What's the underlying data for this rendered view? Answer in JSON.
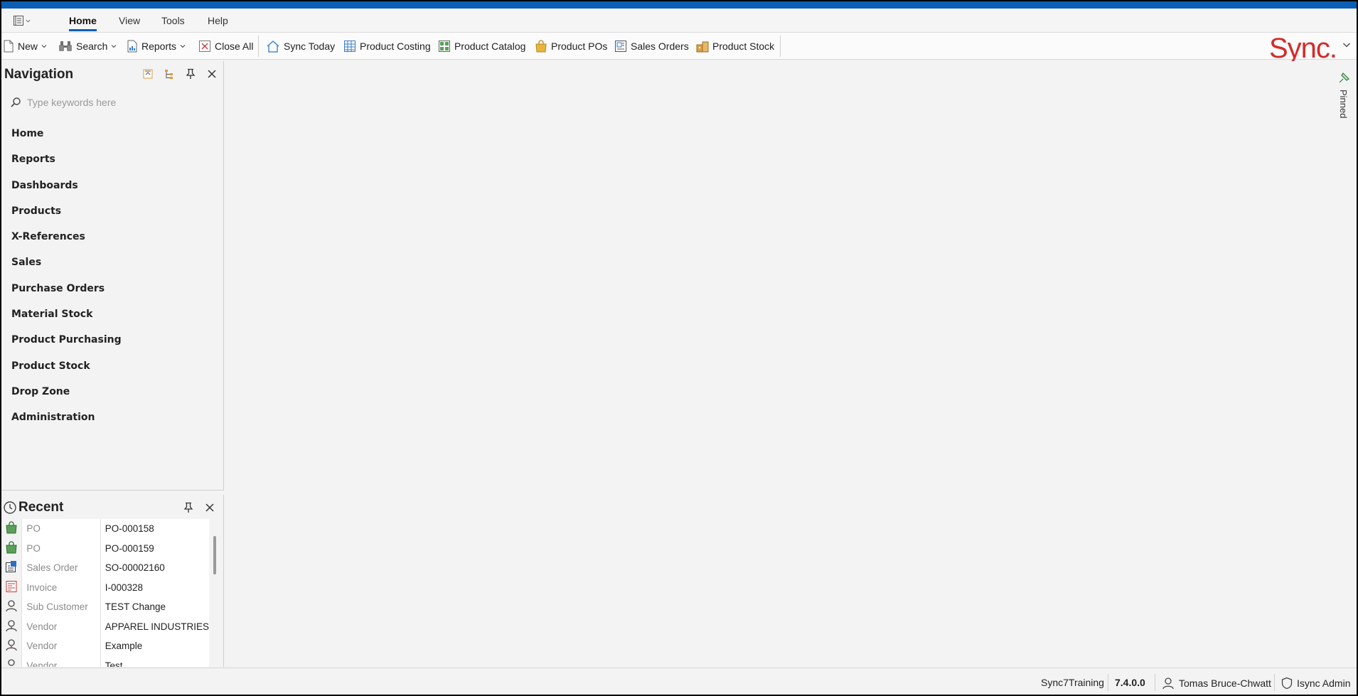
{
  "menubar": {
    "tabs": [
      {
        "label": "Home",
        "active": true
      },
      {
        "label": "View",
        "active": false
      },
      {
        "label": "Tools",
        "active": false
      },
      {
        "label": "Help",
        "active": false
      }
    ]
  },
  "toolbar": {
    "new_label": "New",
    "search_label": "Search",
    "reports_label": "Reports",
    "close_all_label": "Close All",
    "sync_today_label": "Sync Today",
    "product_costing_label": "Product Costing",
    "product_catalog_label": "Product Catalog",
    "product_pos_label": "Product POs",
    "sales_orders_label": "Sales Orders",
    "product_stock_label": "Product Stock",
    "brand": "Sync."
  },
  "navigation": {
    "title": "Navigation",
    "search_placeholder": "Type keywords here",
    "items": [
      "Home",
      "Reports",
      "Dashboards",
      "Products",
      "X-References",
      "Sales",
      "Purchase Orders",
      "Material Stock",
      "Product Purchasing",
      "Product Stock",
      "Drop Zone",
      "Administration"
    ]
  },
  "recent": {
    "title": "Recent",
    "rows": [
      {
        "icon": "shopping-bag-icon",
        "type": "PO",
        "value": "PO-000158"
      },
      {
        "icon": "shopping-bag-icon",
        "type": "PO",
        "value": "PO-000159"
      },
      {
        "icon": "sales-order-icon",
        "type": "Sales Order",
        "value": "SO-00002160"
      },
      {
        "icon": "invoice-icon",
        "type": "Invoice",
        "value": "I-000328"
      },
      {
        "icon": "person-icon",
        "type": "Sub Customer",
        "value": "TEST Change"
      },
      {
        "icon": "vendor-icon",
        "type": "Vendor",
        "value": "APPAREL INDUSTRIES"
      },
      {
        "icon": "vendor-icon",
        "type": "Vendor",
        "value": "Example"
      },
      {
        "icon": "vendor-icon",
        "type": "Vendor",
        "value": "Test"
      }
    ]
  },
  "workspace": {
    "pinned_label": "Pinned"
  },
  "statusbar": {
    "database": "Sync7Training",
    "version": "7.4.0.0",
    "user": "Tomas Bruce-Chwatt",
    "role": "Isync Admin"
  },
  "colors": {
    "accent": "#0a5fb4",
    "brand": "#d42a2a",
    "background": "#f3f3f3"
  }
}
